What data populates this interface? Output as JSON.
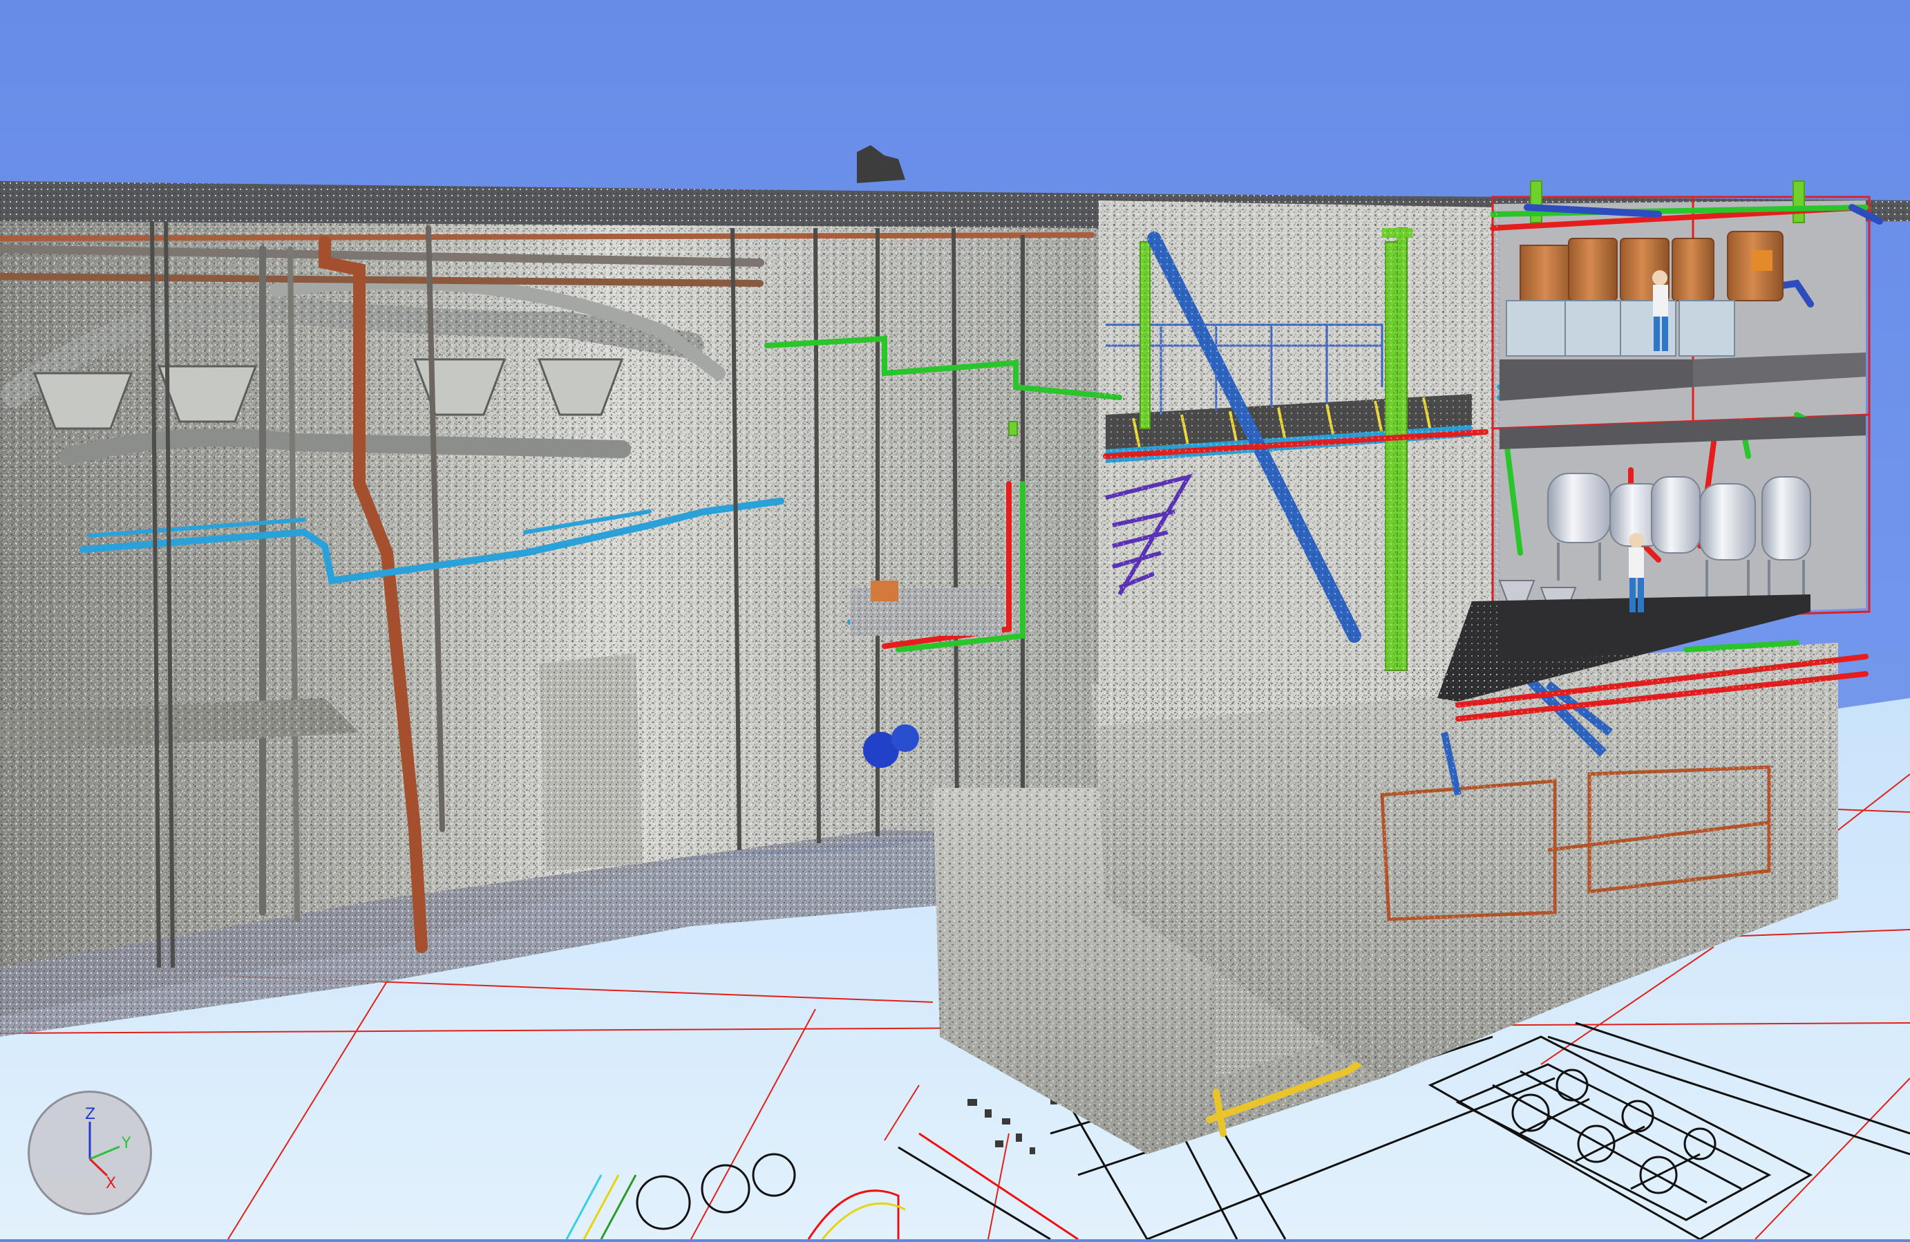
{
  "viewer": {
    "axes": {
      "z": "Z",
      "y": "Y",
      "x": "X"
    },
    "colors": {
      "sky": "#6b8fea",
      "ground": "#d6ecfb",
      "grid_line": "#e0201a",
      "pipe_blue": "#2aa2d9",
      "pipe_green": "#29c52b",
      "pipe_red": "#e51d1d",
      "beam_green": "#6fd22c",
      "tank_copper": "#c57c43",
      "tank_silver": "#e4e8ef"
    },
    "icons": [
      "axis-orientation-icon"
    ]
  }
}
